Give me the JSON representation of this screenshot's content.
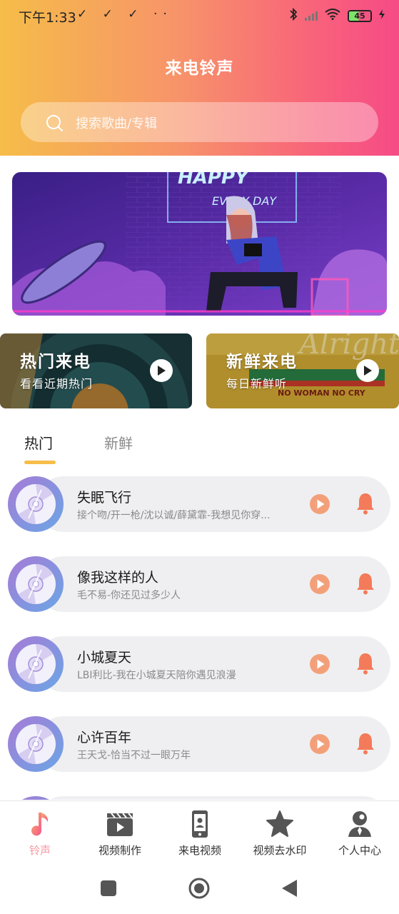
{
  "status_bar": {
    "time": "下午1:33",
    "left_icons": "✓ ✓ ✓ ··",
    "battery": "45"
  },
  "header": {
    "title": "来电铃声",
    "search_placeholder": "搜索歌曲/专辑"
  },
  "banner": {
    "neon_line1": "HAPPY",
    "neon_line2": "EVERY DAY"
  },
  "quick_cards": [
    {
      "title": "热门来电",
      "subtitle": "看看近期热门"
    },
    {
      "title": "新鲜来电",
      "subtitle": "每日新鲜听",
      "art_text": "NO WOMAN NO CRY"
    }
  ],
  "tabs": [
    {
      "label": "热门",
      "active": true
    },
    {
      "label": "新鲜",
      "active": false
    }
  ],
  "songs": [
    {
      "title": "失眠飞行",
      "subtitle": "接个吻/开一枪/沈以诚/薛黛霏-我想见你穿..."
    },
    {
      "title": "像我这样的人",
      "subtitle": "毛不易-你还见过多少人"
    },
    {
      "title": "小城夏天",
      "subtitle": "LBI利比-我在小城夏天陪你遇见浪漫"
    },
    {
      "title": "心许百年",
      "subtitle": "王天戈-恰当不过一眼万年"
    }
  ],
  "bottom_nav": [
    {
      "label": "铃声",
      "icon": "music-note-icon",
      "active": true
    },
    {
      "label": "视频制作",
      "icon": "clapperboard-icon",
      "active": false
    },
    {
      "label": "来电视频",
      "icon": "phone-icon",
      "active": false
    },
    {
      "label": "视频去水印",
      "icon": "star-icon",
      "active": false
    },
    {
      "label": "个人中心",
      "icon": "person-icon",
      "active": false
    }
  ],
  "colors": {
    "header_gradient_start": "#f6bd49",
    "header_gradient_end": "#f64b86",
    "accent": "#f6bd49",
    "play_icon": "#f3a07a",
    "bell_icon": "#f47b5a",
    "active_nav": "#f59aa0"
  }
}
